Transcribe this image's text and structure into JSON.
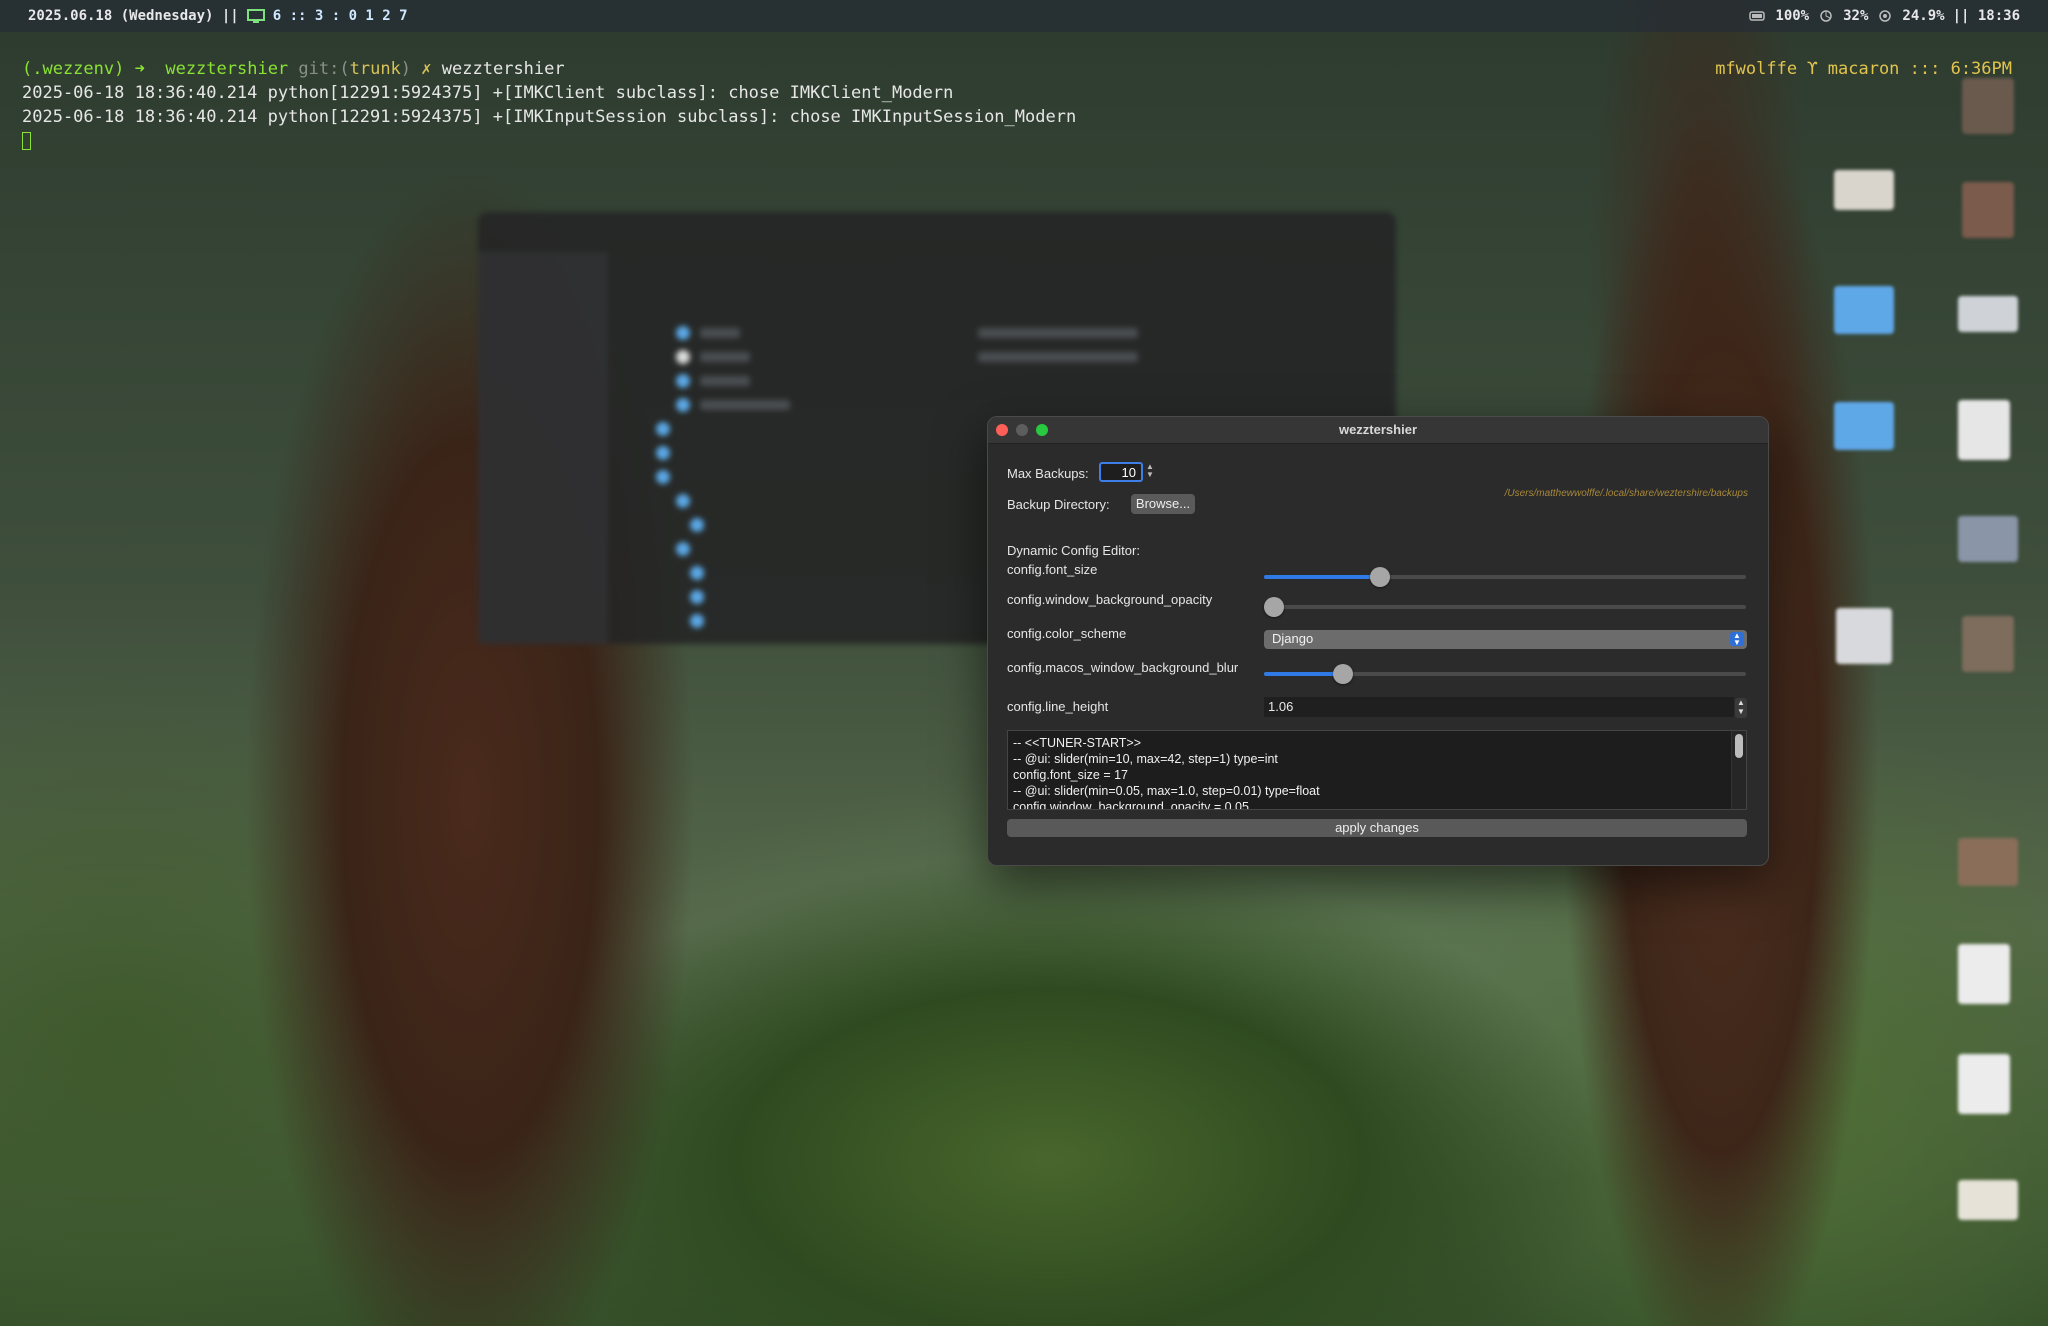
{
  "statusbar": {
    "date": "2025.06.18 (Wednesday) ||",
    "workspaces": "6 :: 3 : 0 1 2 7",
    "battery": "100%",
    "cpu": "32%",
    "mem": "24.9%",
    "time": "|| 18:36"
  },
  "terminal": {
    "prompt_env": "(.wezzenv)",
    "prompt_arrow": "➜",
    "prompt_dir": "wezztershier",
    "prompt_git": "git:(",
    "prompt_branch": "trunk",
    "prompt_git_close": ")",
    "prompt_x": "✗",
    "prompt_cmd": "wezztershier",
    "line1": "2025-06-18 18:36:40.214 python[12291:5924375] +[IMKClient subclass]: chose IMKClient_Modern",
    "line2": "2025-06-18 18:36:40.214 python[12291:5924375] +[IMKInputSession subclass]: chose IMKInputSession_Modern",
    "right_info": "mfwolffe ϒ macaron ::: 6:36PM"
  },
  "window": {
    "title": "wezztershier",
    "max_backups_label": "Max Backups:",
    "max_backups_value": "10",
    "backup_dir_label": "Backup Directory:",
    "browse_label": "Browse...",
    "backup_path": "/Users/matthewwolffe/.local/share/weztershire/backups",
    "dynamic_label": "Dynamic Config Editor:",
    "font_size_label": "config.font_size",
    "font_size_level": 0.23,
    "opacity_label": "config.window_background_opacity",
    "opacity_level": 0.0,
    "color_scheme_label": "config.color_scheme",
    "color_scheme_value": "Django",
    "blur_label": "config.macos_window_background_blur",
    "blur_level": 0.15,
    "line_height_label": "config.line_height",
    "line_height_value": "1.06",
    "code": "-- <<TUNER-START>>\n-- @ui: slider(min=10, max=42, step=1) type=int\nconfig.font_size = 17\n-- @ui: slider(min=0.05, max=1.0, step=0.01) type=float\nconfig.window_background_opacity = 0.05",
    "apply_label": "apply changes"
  },
  "colors": {
    "accent": "#2f7ae5",
    "path": "#a7873a",
    "prompt_green": "#8ae234",
    "right_info": "#e1c44c"
  }
}
